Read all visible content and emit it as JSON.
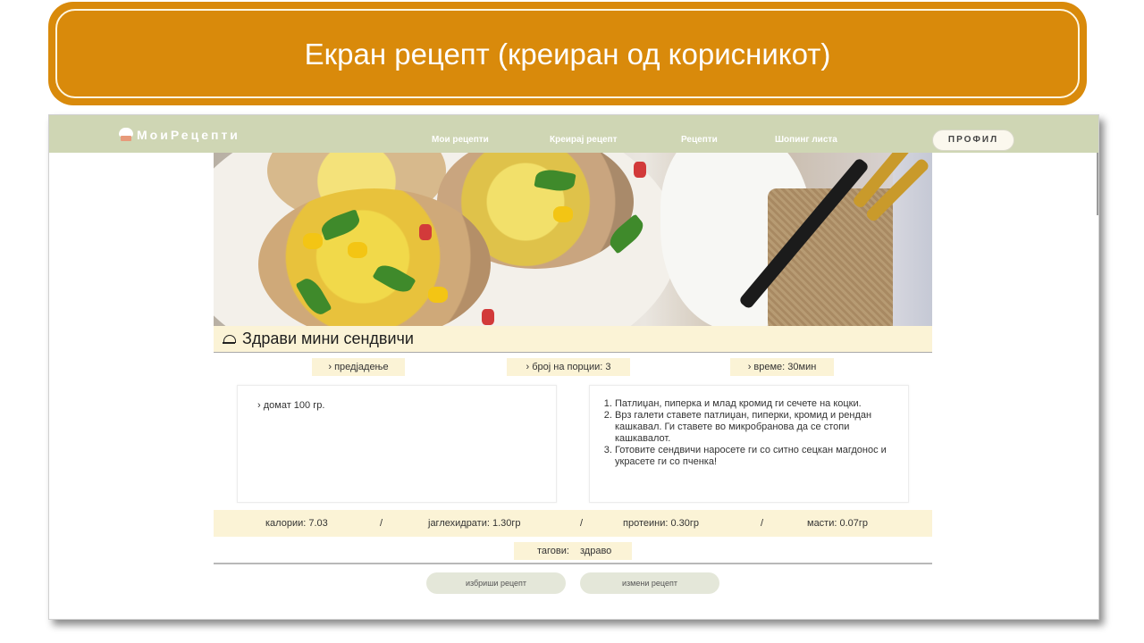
{
  "slide": {
    "title": "Екран рецепт (креиран од корисникот)"
  },
  "navbar": {
    "logo_text": "МоиРецепти",
    "links": [
      "Мои рецепти",
      "Креирај рецепт",
      "Рецепти",
      "Шопинг листа"
    ],
    "profile_label": "ПРОФИЛ"
  },
  "recipe": {
    "title": "Здрави мини сендвичи",
    "category": "› предјадење",
    "servings": "› број на порции: 3",
    "time": "› време: 30мин",
    "ingredients": [
      "› домат 100 гр."
    ],
    "steps": [
      "Патлиџан, пиперка и млад кромид ги сечете на коцки.",
      "Врз галети ставете патлиџан, пиперки, кромид и рендан кашкавал. Ги ставете во микробранова да се стопи кашкавалот.",
      "Готовите сендвичи наросете ги со ситно сецкан магдонос и украсете ги со пченка!"
    ],
    "nutrition": {
      "calories": "калории: 7.03",
      "carbs": "јаглехидрати: 1.30гр",
      "protein": "протеини: 0.30гр",
      "fat": "масти: 0.07гр",
      "separator": "/"
    },
    "tags_label": "тагови:",
    "tags_value": "здраво"
  },
  "actions": {
    "delete_label": "избриши рецепт",
    "edit_label": "измени рецепт"
  },
  "colors": {
    "banner": "#d98a0b",
    "navbar": "#cfd6b4",
    "cream": "#fbf3d6",
    "button": "#e4e7d9"
  }
}
